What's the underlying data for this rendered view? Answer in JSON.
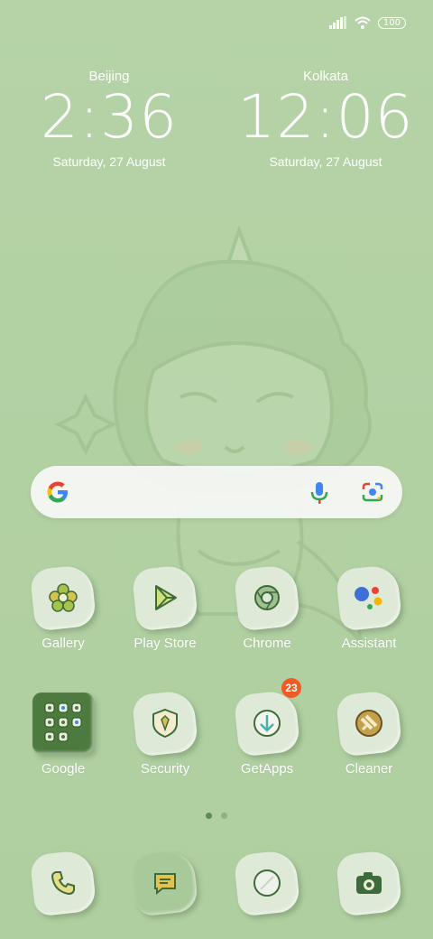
{
  "status": {
    "battery": "100"
  },
  "clocks": [
    {
      "city": "Beijing",
      "time": "2:36",
      "date": "Saturday, 27 August"
    },
    {
      "city": "Kolkata",
      "time": "12:06",
      "date": "Saturday, 27 August"
    }
  ],
  "apps": [
    {
      "label": "Gallery",
      "icon": "gallery-icon"
    },
    {
      "label": "Play Store",
      "icon": "play-store-icon"
    },
    {
      "label": "Chrome",
      "icon": "chrome-icon"
    },
    {
      "label": "Assistant",
      "icon": "assistant-icon"
    },
    {
      "label": "Google",
      "icon": "google-folder-icon"
    },
    {
      "label": "Security",
      "icon": "security-icon"
    },
    {
      "label": "GetApps",
      "icon": "getapps-icon",
      "badge": "23"
    },
    {
      "label": "Cleaner",
      "icon": "cleaner-icon"
    }
  ],
  "dock": [
    {
      "icon": "phone-icon"
    },
    {
      "icon": "messages-icon"
    },
    {
      "icon": "browser-icon"
    },
    {
      "icon": "camera-icon"
    }
  ],
  "pages": {
    "count": 2,
    "active": 1
  },
  "colors": {
    "background": "#b3d2a4",
    "icon_dark": "#3f6b3a",
    "badge": "#f05a24"
  }
}
